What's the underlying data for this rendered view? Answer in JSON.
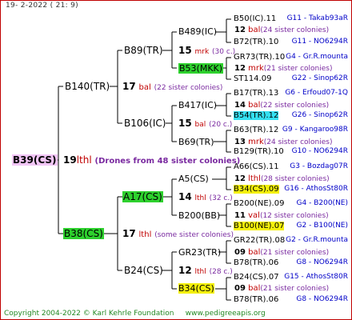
{
  "date": "19-  2-2022  ( 21:  9)",
  "root": {
    "id": "B39(CS)"
  },
  "gen1_connector": {
    "num": "19",
    "code": "lthl",
    "desc": "(Drones from 48 sister colonies)"
  },
  "parents": [
    {
      "id": "B140(TR)",
      "connector": {
        "num": "17",
        "code": "bal",
        "desc": "(22 sister colonies)"
      }
    },
    {
      "id": "B38(CS)",
      "connector": {
        "num": "17",
        "code": "lthl",
        "desc": "(some sister colonies)"
      }
    }
  ],
  "grandparents": [
    {
      "id": "B89(TR)",
      "connector": {
        "num": "15",
        "code": "mrk",
        "desc": "(30 c.)"
      }
    },
    {
      "id": "B106(IC)",
      "connector": {
        "num": "15",
        "code": "bal",
        "desc": "(20 c.)"
      }
    },
    {
      "id": "A17(CS)",
      "connector": {
        "num": "14",
        "code": "lthl",
        "desc": "(32 c.)"
      }
    },
    {
      "id": "B24(CS)",
      "connector": {
        "num": "12",
        "code": "lthl",
        "desc": "(28 c.)"
      }
    }
  ],
  "great_grandparents": [
    {
      "id": "B489(IC)",
      "connector": {
        "num": "12",
        "code": "bal",
        "desc": "(24 sister colonies)"
      }
    },
    {
      "id": "B53(MKK)",
      "connector": {
        "num": "12",
        "code": "mrk",
        "desc": "(21 sister colonies)"
      }
    },
    {
      "id": "B417(IC)",
      "connector": {
        "num": "14",
        "code": "bal",
        "desc": "(22 sister colonies)"
      }
    },
    {
      "id": "B69(TR)",
      "connector": {
        "num": "13",
        "code": "mrk",
        "desc": "(24 sister colonies)"
      }
    },
    {
      "id": "A5(CS)",
      "connector": {
        "num": "12",
        "code": "lthl",
        "desc": "(28 sister colonies)"
      }
    },
    {
      "id": "B200(BB)",
      "connector": {
        "num": "11",
        "code": "val",
        "desc": "(12 sister colonies)"
      }
    },
    {
      "id": "GR23(TR)",
      "connector": {
        "num": "09",
        "code": "bal",
        "desc": "(21 sister colonies)"
      }
    },
    {
      "id": "B34(CS)",
      "connector": {
        "num": "09",
        "code": "bal",
        "desc": "(21 sister colonies)"
      }
    }
  ],
  "leaves": [
    {
      "id": "B50(IC).11",
      "group": "G11 - Takab93aR"
    },
    {
      "id": "B72(TR).10",
      "group": "G11 - NO6294R"
    },
    {
      "id": "GR73(TR).10",
      "group": "G4 - Gr.R.mounta"
    },
    {
      "id": "ST114.09",
      "group": "G22 - Sinop62R"
    },
    {
      "id": "B17(TR).13",
      "group": "G6 - Erfoud07-1Q"
    },
    {
      "id": "B54(TR).12",
      "group": "G26 - Sinop62R"
    },
    {
      "id": "B63(TR).12",
      "group": "G9 - Kangaroo98R"
    },
    {
      "id": "B129(TR).10",
      "group": "G10 - NO6294R"
    },
    {
      "id": "A66(CS).11",
      "group": "G3 - Bozdag07R"
    },
    {
      "id": "B34(CS).09",
      "group": "G16 - AthosSt80R"
    },
    {
      "id": "B200(NE).09",
      "group": "G4 - B200(NE)"
    },
    {
      "id": "B100(NE).07",
      "group": "G2 - B100(NE)"
    },
    {
      "id": "GR22(TR).08",
      "group": "G2 - Gr.R.mounta"
    },
    {
      "id": "B78(TR).06",
      "group": "G8 - NO6294R"
    },
    {
      "id": "B24(CS).07",
      "group": "G15 - AthosSt80R"
    },
    {
      "id": "B78(TR).06",
      "group": "G8 - NO6294R"
    }
  ],
  "footer": {
    "copyright": "Copyright 2004-2022 © Karl Kehrle Foundation",
    "site": "www.pedigreeapis.org"
  },
  "colors": {
    "frame": "#c00000",
    "green": "#2ed12e",
    "cyan": "#34e0f2",
    "yellow": "#f4f00a",
    "root_bg": "#f2c6f6",
    "code": "#c00000",
    "group": "#0000c8",
    "desc": "#7a2aa0"
  }
}
